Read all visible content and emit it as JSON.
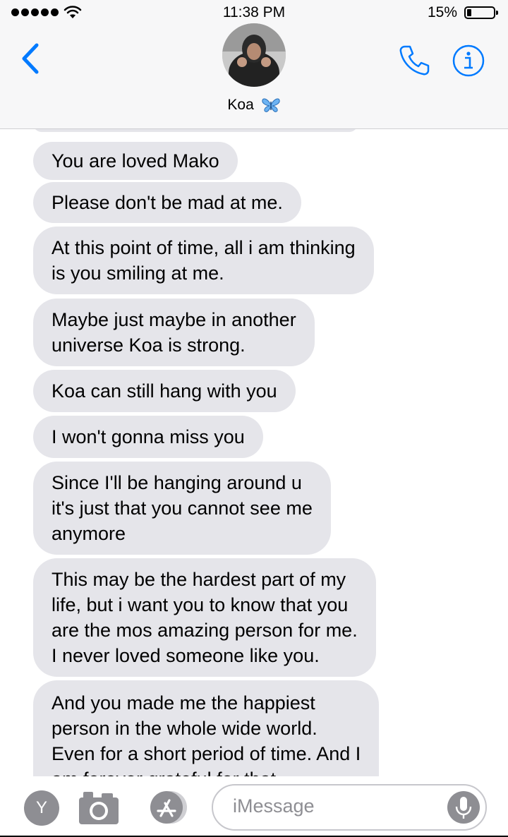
{
  "status_bar": {
    "time": "11:38 PM",
    "battery_percent": "15%",
    "signal_bars": 5,
    "battery_level": 0.15
  },
  "header": {
    "contact_name": "Koa",
    "name_emoji": "butterfly-icon",
    "back_icon": "chevron-left-icon",
    "call_icon": "phone-icon",
    "info_icon": "info-icon",
    "accent_color": "#007aff"
  },
  "messages": [
    {
      "lines": [
        "You are loved Mako"
      ]
    },
    {
      "lines": [
        "Please don't be mad at me."
      ]
    },
    {
      "lines": [
        "At this point of time, all i am thinking",
        "is you smiling at me."
      ]
    },
    {
      "lines": [
        "Maybe just maybe in another",
        "universe Koa is strong."
      ]
    },
    {
      "lines": [
        "Koa can still hang with you"
      ]
    },
    {
      "lines": [
        "I won't gonna miss you"
      ]
    },
    {
      "lines": [
        "Since I'll be hanging around u",
        "it's just that you cannot see me",
        "anymore"
      ]
    },
    {
      "lines": [
        "This may be the hardest part of my",
        "life, but i want you to know that you",
        "are the mos amazing person for me.",
        "I never loved someone like you."
      ]
    },
    {
      "lines": [
        "And you made me the happiest",
        "person in the whole wide world.",
        "Even for a short period of time. And I",
        "am forever grateful for that."
      ]
    }
  ],
  "input_bar": {
    "app_badge": "Y",
    "camera_icon": "camera-icon",
    "appstore_icon": "app-store-icon",
    "placeholder": "iMessage",
    "mic_icon": "microphone-icon"
  }
}
